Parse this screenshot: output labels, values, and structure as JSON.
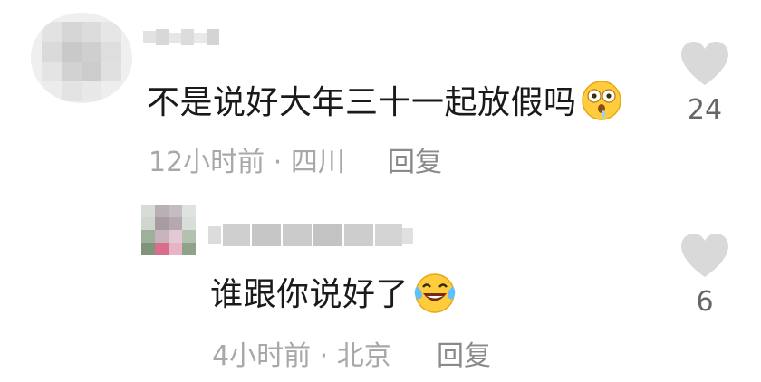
{
  "comments": [
    {
      "text": "不是说好大年三十一起放假吗",
      "emoji": "shocked-drooling-emoji",
      "time": "12小时前",
      "separator": "·",
      "location": "四川",
      "reply_label": "回复",
      "likes": "24",
      "avatar": "blurred-avatar"
    }
  ],
  "replies": [
    {
      "text": "谁跟你说好了",
      "emoji": "laughing-crying-emoji",
      "time": "4小时前",
      "separator": "·",
      "location": "北京",
      "reply_label": "回复",
      "likes": "6",
      "avatar": "blurred-avatar"
    }
  ],
  "colors": {
    "text": "#1a1a1a",
    "meta": "#a8a8a8",
    "heart": "#d9d9d9",
    "like_count": "#666666"
  }
}
